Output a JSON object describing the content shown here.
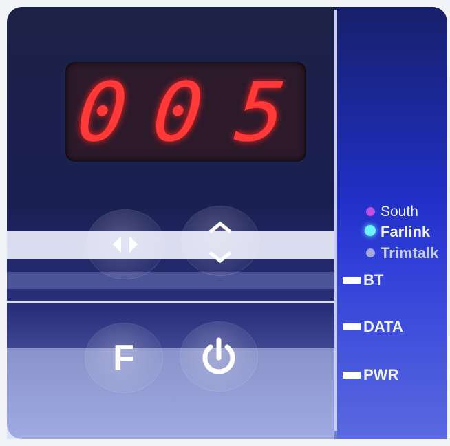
{
  "display": {
    "d1": "0",
    "d2": "0",
    "d3": "5"
  },
  "indicators": [
    {
      "label": "South",
      "color": "#c050e0"
    },
    {
      "label": "Farlink",
      "color": "#6cf3ff"
    },
    {
      "label": "Trimtalk",
      "color": "#a6a9d8"
    }
  ],
  "status_labels": {
    "bt": "BT",
    "data": "DATA",
    "pwr": "PWR"
  },
  "buttons": {
    "f_label": "F"
  },
  "colors": {
    "digits": "#ff3838",
    "panel": "#1d2247",
    "side": "#2030c8"
  }
}
